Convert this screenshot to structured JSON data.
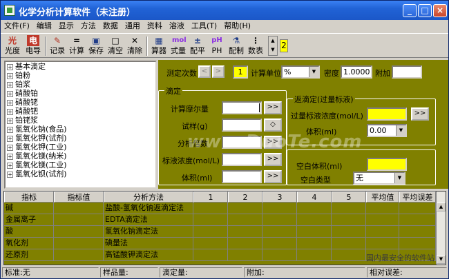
{
  "window": {
    "title": "化学分析计算软件（未注册）",
    "controls": [
      "_",
      "□",
      "×"
    ]
  },
  "menu": [
    "文件(F)",
    "编辑",
    "显示",
    "方法",
    "数据",
    "通用",
    "资料",
    "溶液",
    "工具(T)",
    "帮助(H)"
  ],
  "toolbar": {
    "items": [
      {
        "icon": "光",
        "label": "光度"
      },
      {
        "icon": "电",
        "label": "电导"
      },
      {
        "icon": "✎",
        "label": "记录"
      },
      {
        "icon": "=",
        "label": "计算"
      },
      {
        "icon": "▣",
        "label": "保存"
      },
      {
        "icon": "□",
        "label": "清空"
      },
      {
        "icon": "✕",
        "label": "清除"
      },
      {
        "icon": "▦",
        "label": "算器"
      },
      {
        "icon": "mol",
        "label": "式量"
      },
      {
        "icon": "±",
        "label": "配平"
      },
      {
        "icon": "pH",
        "label": "PH"
      },
      {
        "icon": "⚗",
        "label": "配制"
      },
      {
        "icon": "⋮",
        "label": "数表"
      }
    ],
    "spinner_value": "2"
  },
  "tree": {
    "items": [
      "基本滴定",
      "铂粉",
      "铂浆",
      "硝酸铂",
      "硝酸铑",
      "硝酸钯",
      "铂铑浆",
      "氢氧化钠(食品)",
      "氢氧化钾(试剂)",
      "氢氧化钾(工业)",
      "氢氧化镁(纳米)",
      "氢氧化镁(工业)",
      "氢氧化钡(试剂)"
    ]
  },
  "controls": {
    "measure_count_label": "测定次数",
    "measure_count_value": "1",
    "calc_unit_label": "计算单位",
    "calc_unit_value": "%",
    "density_label": "密度",
    "density_value": "1.0000",
    "extra_label": "附加",
    "extra_value": ""
  },
  "titration": {
    "group_label": "滴定",
    "molarity_label": "计算摩尔量",
    "sample_label": "试样(g)",
    "factor_label": "分析倍数",
    "std_conc_label": "标液浓度(mol/L)",
    "volume_label": "体积(ml)",
    "arrow_btn": ">>",
    "diamond_btn": "◇"
  },
  "back_titration": {
    "group_label": "返滴定(过量标液)",
    "conc_label": "过量标液浓度(mol/L)",
    "volume_label": "体积(ml)",
    "volume_value": "0.00"
  },
  "blank": {
    "volume_label": "空白体积(ml)",
    "type_label": "空白类型",
    "type_value": "无"
  },
  "grid": {
    "headers": [
      "指标",
      "指标值",
      "分析方法",
      "1",
      "2",
      "3",
      "4",
      "5",
      "平均值",
      "平均误差"
    ],
    "rows": [
      [
        "碱",
        "",
        "盐酸-氢氧化钠返滴定法"
      ],
      [
        "金属离子",
        "",
        "EDTA滴定法"
      ],
      [
        "酸",
        "",
        "氢氧化钠滴定法"
      ],
      [
        "氧化剂",
        "",
        "碘量法"
      ],
      [
        "还原剂",
        "",
        "高锰酸钾滴定法"
      ]
    ]
  },
  "status": [
    "标准:无",
    "样品量:",
    "滴定量:",
    "附加:",
    "相对误差:"
  ],
  "watermark": "www.DuoTe.com",
  "corner_text": "国内最安全的软件站"
}
